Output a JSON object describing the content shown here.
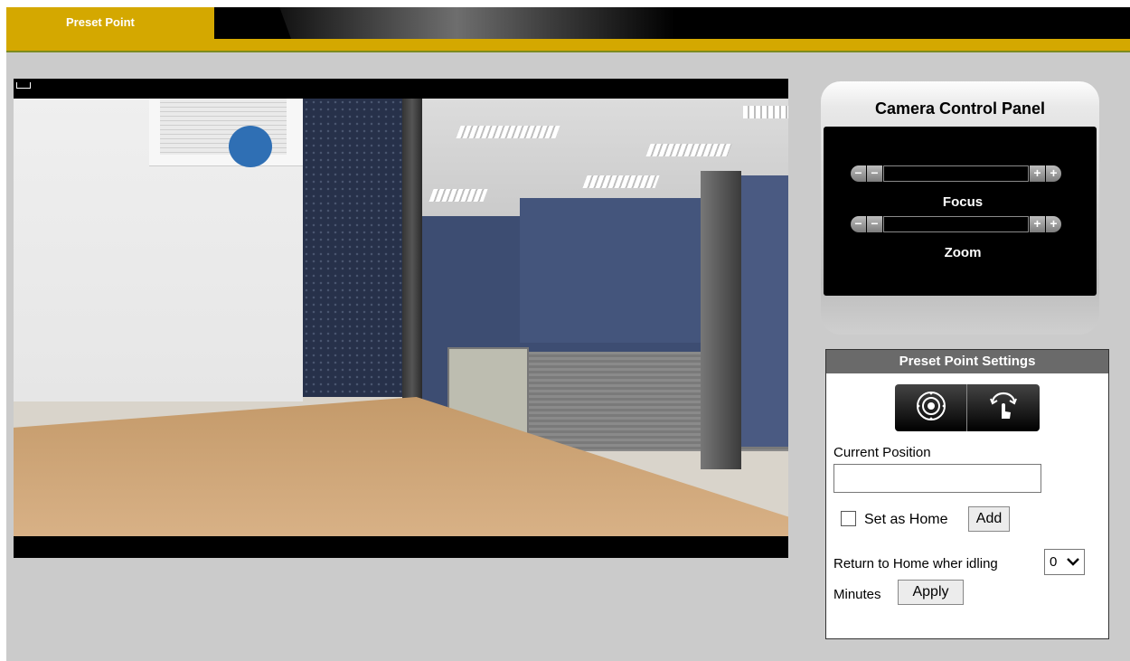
{
  "header": {
    "tab_label": "Preset Point"
  },
  "camera_panel": {
    "title": "Camera Control Panel",
    "focus_label": "Focus",
    "zoom_label": "Zoom",
    "minus_glyph": "−",
    "plus_glyph": "+"
  },
  "preset_settings": {
    "title": "Preset Point Settings",
    "current_position_label": "Current Position",
    "current_position_value": "",
    "set_home_label": "Set as Home",
    "set_home_checked": false,
    "add_label": "Add",
    "return_label": "Return to Home wher idling",
    "idle_minutes_value": "0",
    "minutes_label": "Minutes",
    "apply_label": "Apply"
  },
  "colors": {
    "accent": "#d4a800",
    "panel_header": "#6a6a6a",
    "background": "#cbcbcb"
  },
  "icons": [
    "focus-target-icon",
    "tap-rotate-icon",
    "chevron-down-icon"
  ]
}
